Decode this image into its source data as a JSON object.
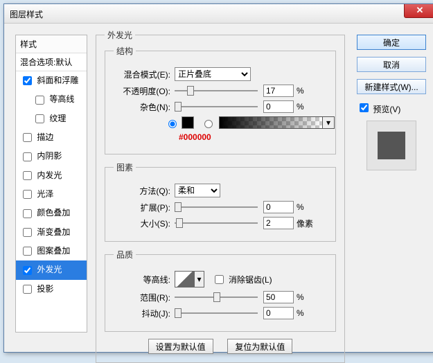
{
  "window": {
    "title": "图层样式"
  },
  "sidebar": {
    "header": "样式",
    "blend_defaults": "混合选项:默认",
    "items": [
      {
        "label": "斜面和浮雕",
        "checked": true,
        "indent": false
      },
      {
        "label": "等高线",
        "checked": false,
        "indent": true
      },
      {
        "label": "纹理",
        "checked": false,
        "indent": true
      },
      {
        "label": "描边",
        "checked": false,
        "indent": false
      },
      {
        "label": "内阴影",
        "checked": false,
        "indent": false
      },
      {
        "label": "内发光",
        "checked": false,
        "indent": false
      },
      {
        "label": "光泽",
        "checked": false,
        "indent": false
      },
      {
        "label": "颜色叠加",
        "checked": false,
        "indent": false
      },
      {
        "label": "渐变叠加",
        "checked": false,
        "indent": false
      },
      {
        "label": "图案叠加",
        "checked": false,
        "indent": false
      },
      {
        "label": "外发光",
        "checked": true,
        "indent": false,
        "selected": true
      },
      {
        "label": "投影",
        "checked": false,
        "indent": false
      }
    ]
  },
  "panel": {
    "title": "外发光",
    "structure": {
      "legend": "结构",
      "blend_label": "混合模式(E):",
      "blend_value": "正片叠底",
      "opacity_label": "不透明度(O):",
      "opacity_value": "17",
      "noise_label": "杂色(N):",
      "noise_value": "0",
      "percent": "%",
      "color_hex": "#000000"
    },
    "elements": {
      "legend": "图素",
      "technique_label": "方法(Q):",
      "technique_value": "柔和",
      "spread_label": "扩展(P):",
      "spread_value": "0",
      "size_label": "大小(S):",
      "size_value": "2",
      "percent": "%",
      "px": "像素"
    },
    "quality": {
      "legend": "品质",
      "contour_label": "等高线:",
      "antialias_label": "消除锯齿(L)",
      "range_label": "范围(R):",
      "range_value": "50",
      "jitter_label": "抖动(J):",
      "jitter_value": "0",
      "percent": "%"
    },
    "footer": {
      "set_default": "设置为默认值",
      "reset_default": "复位为默认值"
    }
  },
  "buttons": {
    "ok": "确定",
    "cancel": "取消",
    "new_style": "新建样式(W)...",
    "preview": "预览(V)"
  }
}
